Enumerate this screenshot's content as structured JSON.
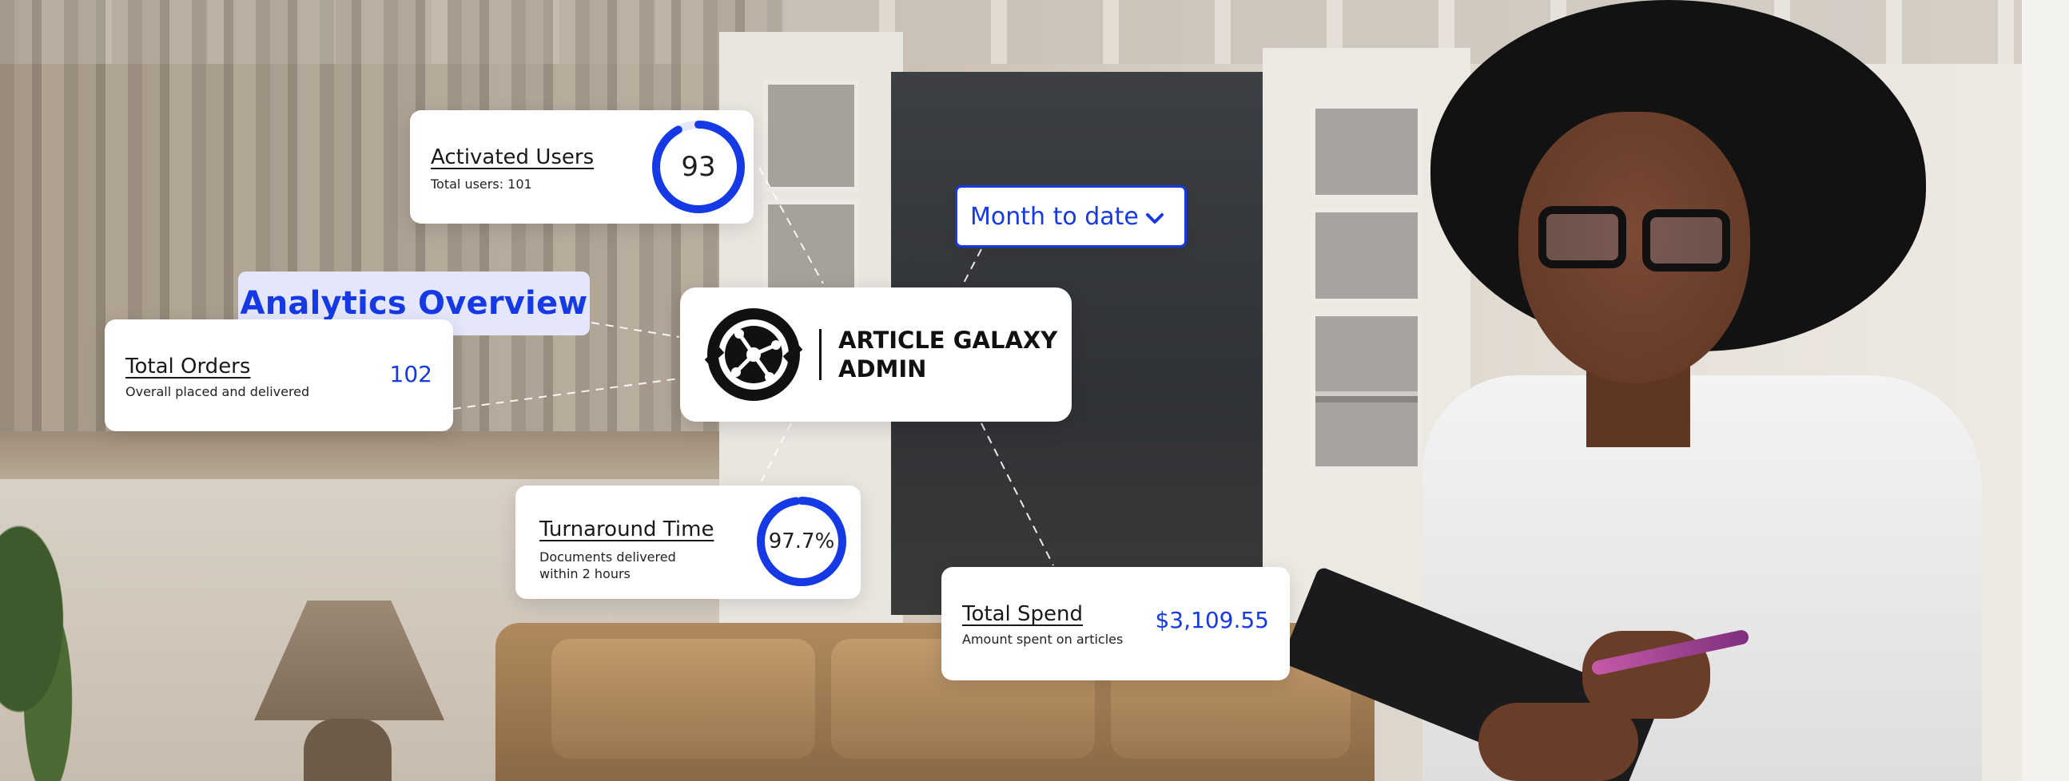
{
  "brand": {
    "name_line1": "ARTICLE GALAXY",
    "name_line2": "ADMIN",
    "logo_icon": "article-galaxy-logo-icon"
  },
  "overview": {
    "title": "Analytics Overview"
  },
  "date_filter": {
    "selected": "Month to date",
    "icon": "chevron-down-icon"
  },
  "cards": {
    "activated_users": {
      "title": "Activated Users",
      "subtitle": "Total users: 101",
      "value": "93",
      "progress_fraction": 0.92
    },
    "total_orders": {
      "title": "Total Orders",
      "subtitle": "Overall placed and delivered",
      "value": "102"
    },
    "turnaround_time": {
      "title": "Turnaround Time",
      "subtitle_line1": "Documents delivered",
      "subtitle_line2": "within 2 hours",
      "value": "97.7%",
      "progress_fraction": 0.977
    },
    "total_spend": {
      "title": "Total Spend",
      "subtitle": "Amount spent on articles",
      "value": "$3,109.55"
    }
  },
  "colors": {
    "accent": "#1639e6",
    "ring_track": "#e4e7fb",
    "tag_background": "#e4e7fb",
    "text_dark": "#1a1a1a",
    "card_background": "#ffffff"
  }
}
